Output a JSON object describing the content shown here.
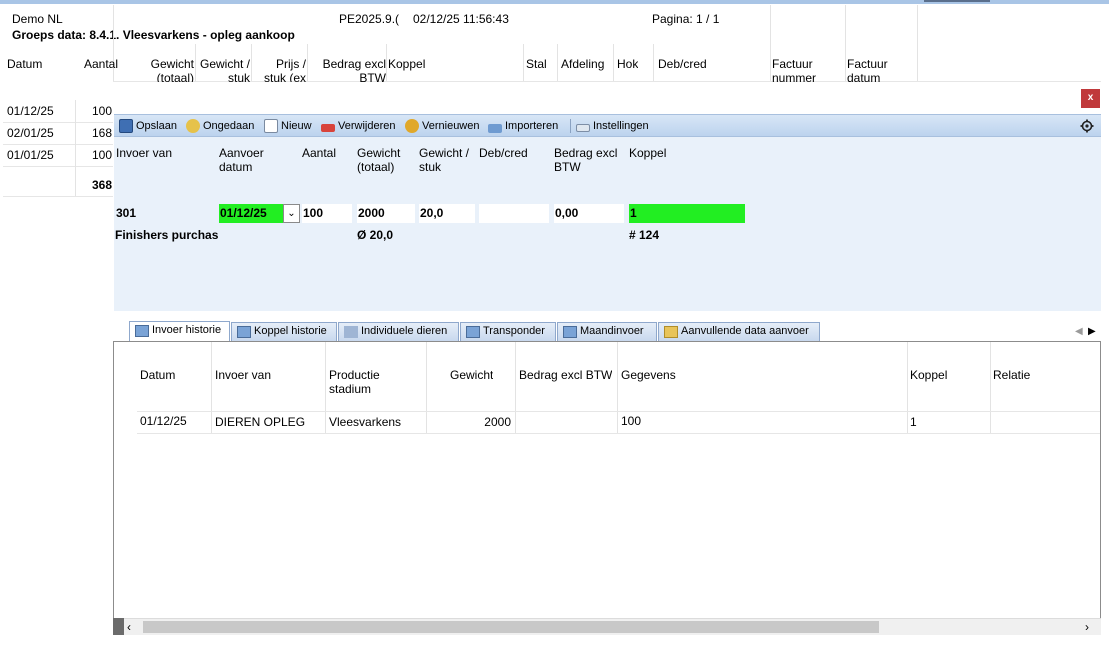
{
  "report": {
    "company": "Demo NL",
    "version": "PE2025.9.(",
    "datetime": "02/12/25 11:56:43",
    "page": "Pagina: 1 / 1",
    "group": "Groeps data: 8.4.1. Vleesvarkens - opleg aankoop"
  },
  "report_columns": [
    "Datum",
    "Aantal",
    "Gewicht (totaal)",
    "Gewicht / stuk",
    "Prijs / stuk (ex",
    "Bedrag excl BTW",
    "Koppel",
    "Stal",
    "Afdeling",
    "Hok",
    "Deb/cred",
    "Factuur nummer",
    "Factuur datum"
  ],
  "report_rows": [
    {
      "datum": "01/12/25",
      "aantal": "100"
    },
    {
      "datum": "02/01/25",
      "aantal": "168"
    },
    {
      "datum": "01/01/25",
      "aantal": "100"
    }
  ],
  "report_total": "368",
  "toolbar": {
    "save": "Opslaan",
    "undo": "Ongedaan",
    "new": "Nieuw",
    "delete": "Verwijderen",
    "refresh": "Vernieuwen",
    "import": "Importeren",
    "settings": "Instellingen",
    "close": "x"
  },
  "form": {
    "headers": [
      "Invoer van",
      "Aanvoer datum",
      "Aantal",
      "Gewicht (totaal)",
      "Gewicht / stuk",
      "Deb/cred",
      "Bedrag excl BTW",
      "Koppel"
    ],
    "row": {
      "invoer_van": "301",
      "aanvoer_datum": "01/12/25",
      "aantal": "100",
      "gewicht_totaal": "2000",
      "gewicht_stuk": "20,0",
      "deb_cred": "",
      "bedrag": "0,00",
      "koppel": "1"
    },
    "summary": {
      "label": "Finishers purchas",
      "avg_weight": "Ø 20,0",
      "count": "# 124"
    }
  },
  "tabs": [
    "Invoer historie",
    "Koppel historie",
    "Individuele dieren",
    "Transponder",
    "Maandinvoer",
    "Aanvullende data aanvoer"
  ],
  "history": {
    "columns": [
      "Datum",
      "Invoer van",
      "Productie stadium",
      "Gewicht",
      "Bedrag excl BTW",
      "Gegevens",
      "Koppel",
      "Relatie"
    ],
    "rows": [
      {
        "datum": "01/12/25",
        "invoer_van": "DIEREN OPLEG",
        "stadium": "Vleesvarkens",
        "gewicht": "2000",
        "bedrag": "",
        "gegevens": "100",
        "koppel": "1",
        "relatie": ""
      }
    ]
  },
  "colors": {
    "accent": "#bcd3ee",
    "highlight": "#22ee22",
    "close": "#c0393b"
  }
}
